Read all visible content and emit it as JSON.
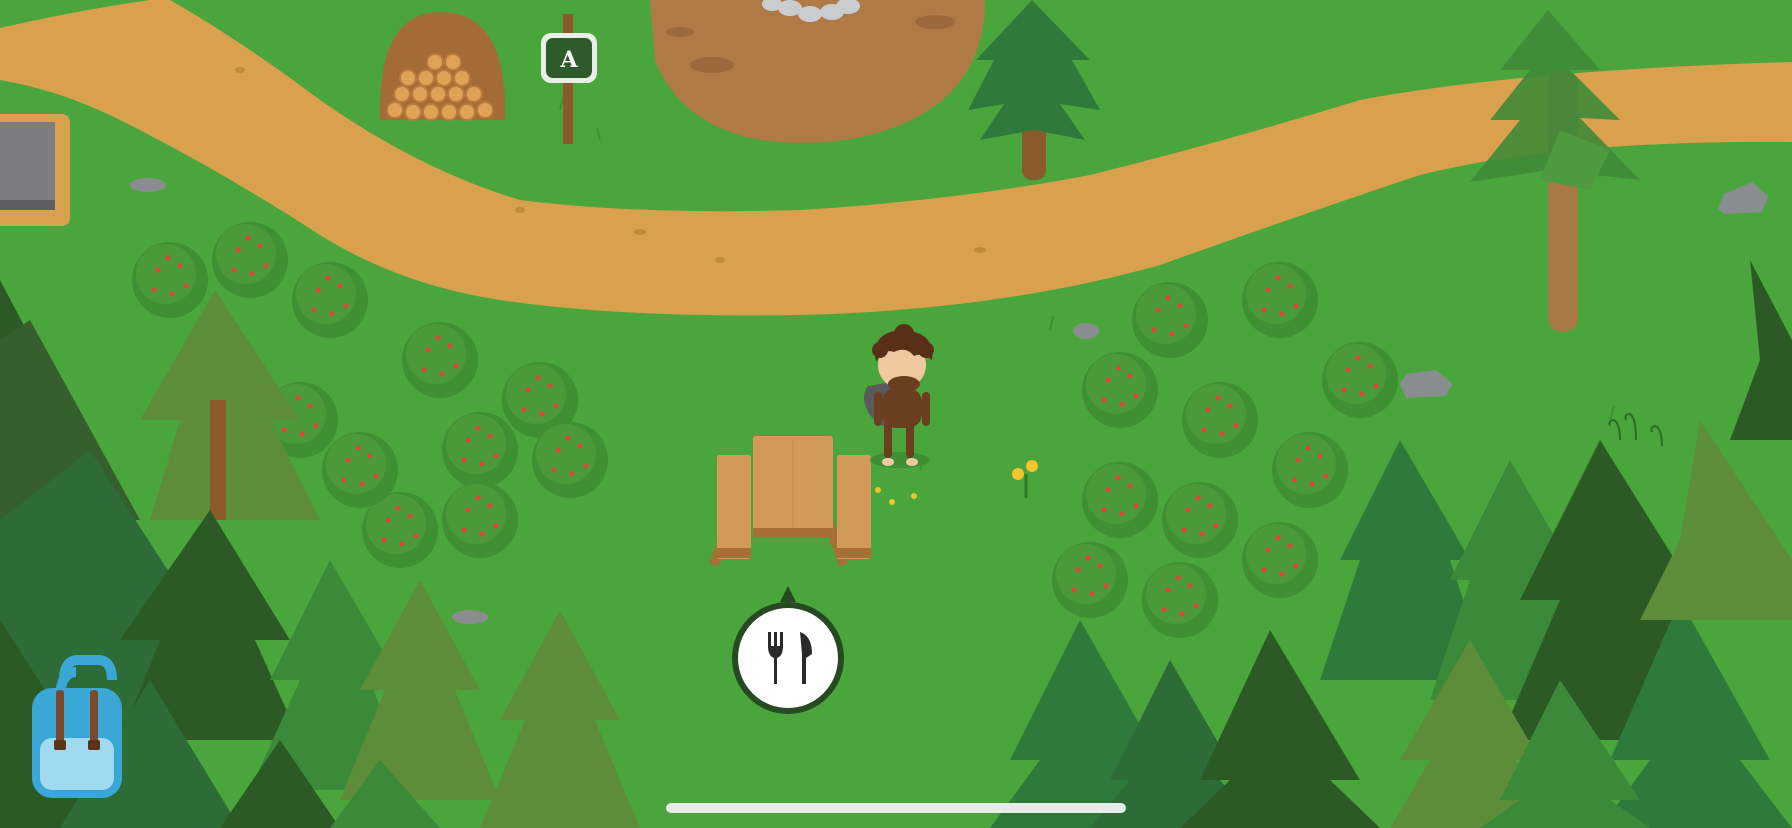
{
  "map": {
    "sign": {
      "letter": "A"
    }
  },
  "hud": {
    "backpack": {
      "icon": "backpack-icon"
    },
    "action": {
      "icon": "fork-knife-icon",
      "action": "eat"
    },
    "home_indicator": true
  },
  "colors": {
    "grass": "#4aa63c",
    "path": "#d9a04e",
    "dirt": "#b07a46",
    "dark_tree": "#2c5a22",
    "mid_tree": "#3b8a3a",
    "olive_tree": "#5e8d3a",
    "bush": "#3f8f33",
    "berry": "#e0443a",
    "wood": "#c8914f",
    "backpack": "#3ba7d6",
    "hud_white": "#ffffff",
    "hud_dark": "#264b22"
  }
}
